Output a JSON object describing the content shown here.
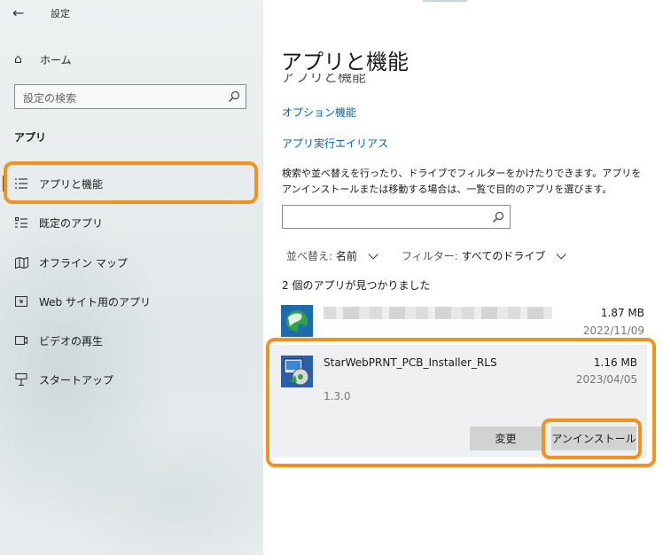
{
  "window": {
    "back_icon": "back-arrow-icon",
    "title": "設定"
  },
  "sidebar": {
    "home": {
      "icon": "home-icon",
      "label": "ホーム"
    },
    "search": {
      "placeholder": "設定の検索",
      "icon": "search-icon"
    },
    "section": "アプリ",
    "items": [
      {
        "label": "アプリと機能",
        "icon": "apps-features-icon",
        "active": true
      },
      {
        "label": "既定のアプリ",
        "icon": "default-apps-icon",
        "active": false
      },
      {
        "label": "オフライン マップ",
        "icon": "offline-maps-icon",
        "active": false
      },
      {
        "label": "Web サイト用のアプリ",
        "icon": "apps-for-websites-icon",
        "active": false
      },
      {
        "label": "ビデオの再生",
        "icon": "video-playback-icon",
        "active": false
      },
      {
        "label": "スタートアップ",
        "icon": "startup-icon",
        "active": false
      }
    ]
  },
  "main": {
    "title": "アプリと機能",
    "ghost_title": "アプリと機能",
    "links": {
      "optional_features": "オプション機能",
      "app_execution_aliases": "アプリ実行エイリアス"
    },
    "description": "検索や並べ替えを行ったり、ドライブでフィルターをかけたりできます。アプリをアンインストールまたは移動する場合は、一覧で目的のアプリを選びます。",
    "app_search": {
      "value": "",
      "icon": "search-icon"
    },
    "sort": {
      "label": "並べ替え:",
      "value": "名前"
    },
    "filter": {
      "label": "フィルター:",
      "value": "すべてのドライブ"
    },
    "result_count": "2 個のアプリが見つかりました",
    "apps": [
      {
        "name": "",
        "size": "1.87 MB",
        "date": "2022/11/09",
        "icon": "globe-app-icon"
      },
      {
        "name": "StarWebPRNT_PCB_Installer_RLS",
        "size": "1.16 MB",
        "date": "2023/04/05",
        "version": "1.3.0",
        "icon": "installer-app-icon",
        "buttons": {
          "modify": "変更",
          "uninstall": "アンインストール"
        }
      }
    ]
  },
  "colors": {
    "highlight": "#f3931f",
    "accent": "#0063b1",
    "sidebar_bg": "#e4eaec"
  }
}
